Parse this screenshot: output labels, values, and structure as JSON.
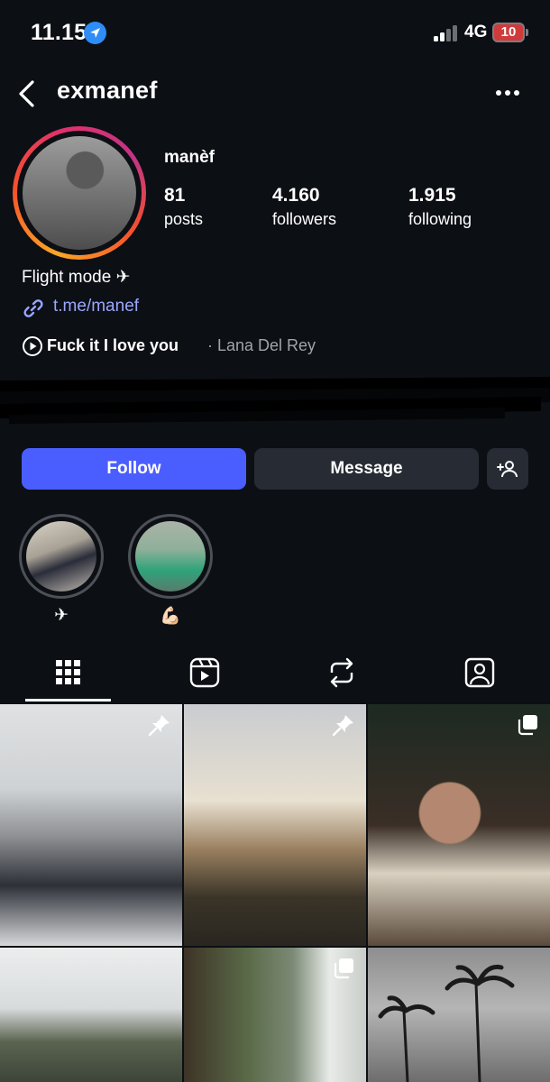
{
  "status_bar": {
    "time": "11.15",
    "network": "4G",
    "battery": "10",
    "icons": [
      "location-icon",
      "signal-icon",
      "battery-icon"
    ]
  },
  "header": {
    "username": "exmanef",
    "icons": [
      "back-arrow-icon",
      "more-options-icon"
    ]
  },
  "profile": {
    "display_name": "manèf",
    "stats": {
      "posts": {
        "value": "81",
        "label": "posts"
      },
      "followers": {
        "value": "4.160",
        "label": "followers"
      },
      "following": {
        "value": "1.915",
        "label": "following"
      }
    },
    "bio": "Flight mode ✈",
    "link": "t.me/manef",
    "music": {
      "song": "Fuck it I love you",
      "artist": "· Lana Del Rey"
    },
    "avatar_ring_colors": [
      "#f9a826",
      "#e1306c",
      "#c13584"
    ]
  },
  "actions": {
    "follow": "Follow",
    "message": "Message",
    "suggest_icon": "add-person-icon",
    "follow_color": "#4a5eff"
  },
  "highlights": [
    {
      "label": "✈"
    },
    {
      "label": "💪🏻"
    }
  ],
  "tabs": [
    "grid-icon",
    "reels-icon",
    "reposts-icon",
    "tagged-icon"
  ],
  "posts": [
    {
      "badge": "pin-icon"
    },
    {
      "badge": "pin-icon"
    },
    {
      "badge": "carousel-icon"
    },
    {
      "badge": ""
    },
    {
      "badge": "carousel-icon"
    },
    {
      "badge": ""
    }
  ]
}
